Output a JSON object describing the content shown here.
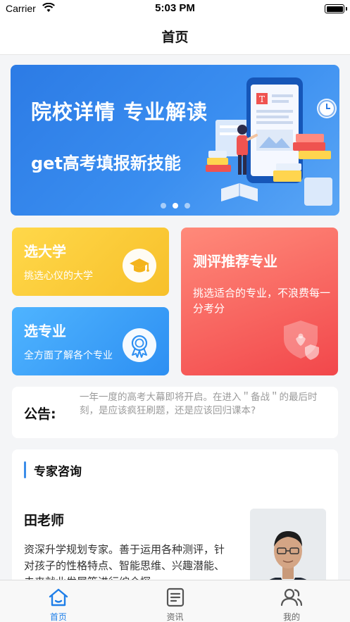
{
  "status_bar": {
    "carrier": "Carrier",
    "time": "5:03 PM"
  },
  "nav": {
    "title": "首页"
  },
  "banner": {
    "title": "院校详情 专业解读",
    "subtitle": "get高考填报新技能",
    "pages": 3,
    "active_page": 2
  },
  "cards": {
    "university": {
      "title": "选大学",
      "desc": "挑选心仪的大学",
      "icon": "graduation-cap-icon"
    },
    "major": {
      "title": "选专业",
      "desc": "全方面了解各个专业",
      "icon": "award-ribbon-icon"
    },
    "evaluation": {
      "title": "测评推荐专业",
      "desc": "挑选适合的专业，不浪费每一分考分",
      "icon": "shield-icon"
    }
  },
  "notice": {
    "label": "公告:",
    "text": "一年一度的高考大幕即将开启。在进入＂备战＂的最后时刻，是应该疯狂刷题，还是应该回归课本?"
  },
  "expert": {
    "heading": "专家咨询",
    "name": "田老师",
    "desc": "资深升学规划专家。善于运用各种测评，针对孩子的性格特点、智能思维、兴趣潜能、未来就业发展等进行综合探"
  },
  "tabs": [
    {
      "label": "首页",
      "icon": "home-icon",
      "active": true
    },
    {
      "label": "资讯",
      "icon": "news-icon",
      "active": false
    },
    {
      "label": "我的",
      "icon": "user-icon",
      "active": false
    }
  ],
  "colors": {
    "accent": "#1e7ee8",
    "banner": "#2c7be5",
    "card_yellow": "#f7c02a",
    "card_blue": "#2d8ff2",
    "card_red": "#f2474b"
  }
}
